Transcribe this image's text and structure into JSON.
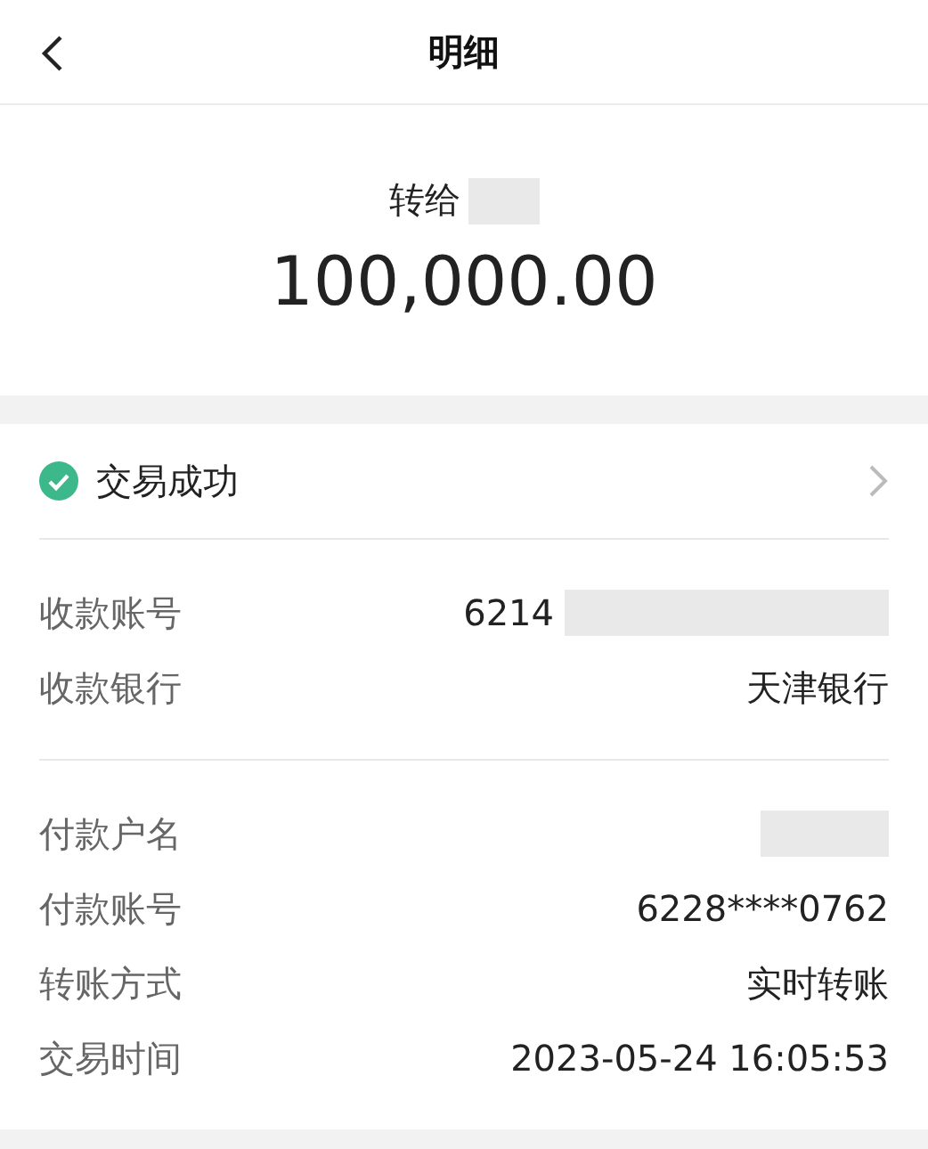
{
  "header": {
    "title": "明细"
  },
  "transfer": {
    "prefix": "转给",
    "recipient_masked": true,
    "amount": "100,000.00"
  },
  "status": {
    "text": "交易成功",
    "success": true
  },
  "groups": [
    [
      {
        "label": "收款账号",
        "value": "6214",
        "masked": true
      },
      {
        "label": "收款银行",
        "value": "天津银行",
        "masked": false
      }
    ],
    [
      {
        "label": "付款户名",
        "masked": true
      },
      {
        "label": "付款账号",
        "value": "6228****0762",
        "masked": false
      },
      {
        "label": "转账方式",
        "value": "实时转账",
        "masked": false
      },
      {
        "label": "交易时间",
        "value": "2023-05-24 16:05:53",
        "masked": false
      }
    ]
  ]
}
